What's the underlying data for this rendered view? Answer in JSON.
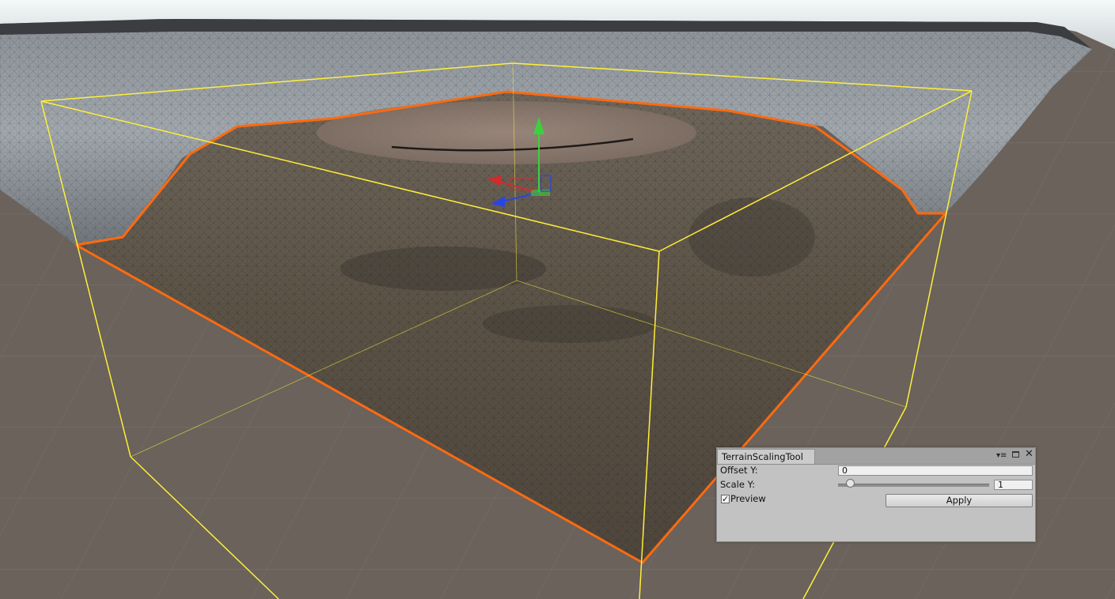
{
  "tool_window": {
    "title": "TerrainScalingTool",
    "icons": {
      "menu": "window-menu-icon",
      "maximize": "maximize-icon",
      "close": "close-icon"
    },
    "offset_y": {
      "label": "Offset Y:",
      "value": "0"
    },
    "scale_y": {
      "label": "Scale Y:",
      "value": "1",
      "slider_fraction": 0.08
    },
    "preview": {
      "label": "Preview",
      "checked": true
    },
    "apply_label": "Apply"
  },
  "scene": {
    "ground_color": "#6a625b",
    "selection_outline_color": "#ff6a10",
    "bounds_color": "#ffef3a",
    "gizmo_axes": [
      "y-axis-arrow",
      "x-axis-arrow",
      "z-axis-arrow"
    ]
  }
}
